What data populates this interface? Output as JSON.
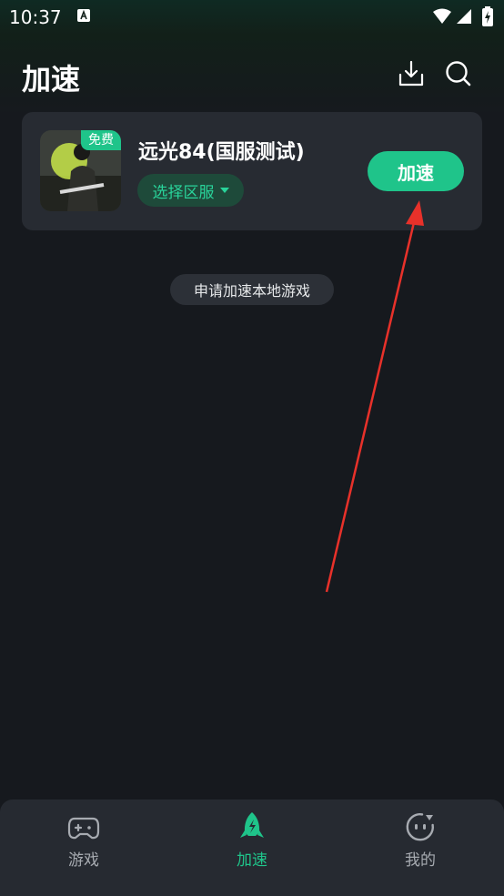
{
  "status_bar": {
    "time": "10:37"
  },
  "header": {
    "title": "加速"
  },
  "game_card": {
    "badge": "免费",
    "name": "远光84(国服测试)",
    "server_select_label": "选择区服",
    "accelerate_label": "加速"
  },
  "request_local_label": "申请加速本地游戏",
  "bottom_nav": {
    "items": [
      {
        "label": "游戏",
        "icon": "gamepad-icon",
        "active": false
      },
      {
        "label": "加速",
        "icon": "rocket-icon",
        "active": true
      },
      {
        "label": "我的",
        "icon": "face-icon",
        "active": false
      }
    ]
  },
  "colors": {
    "accent": "#1fc48a",
    "annotation_arrow": "#e8312a"
  }
}
